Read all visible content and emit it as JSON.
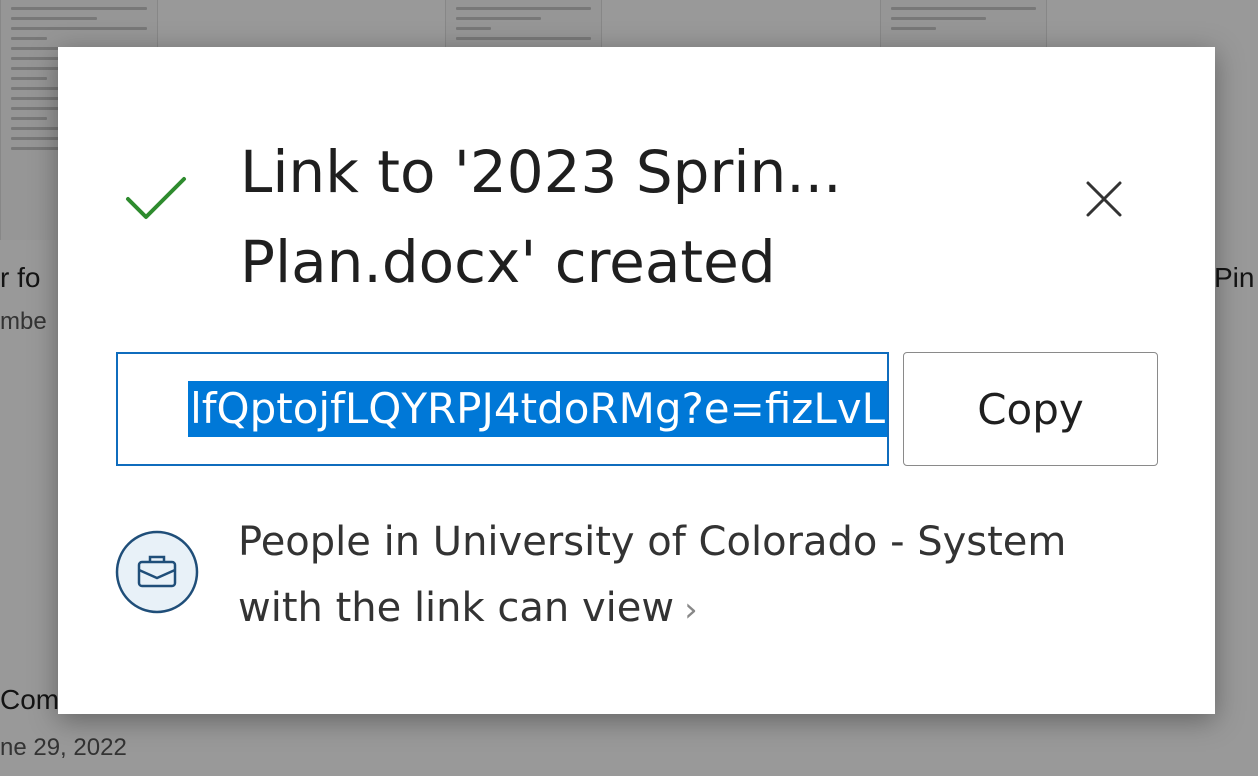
{
  "background": {
    "left_title_fragment": "r fo",
    "left_sub_fragment": "mbe",
    "right_title_fragment": "Pin",
    "bottom_title_fragment": "Comms Plan tra...",
    "bottom_date_fragment": "ne 29, 2022"
  },
  "dialog": {
    "title": "Link to '2023 Sprin... Plan.docx' created",
    "link_value": "lfQptojfLQYRPJ4tdoRMg?e=fizLvL",
    "copy_label": "Copy",
    "permission_text": "People in University of Colorado - System with the link can view",
    "chevron": "›"
  },
  "colors": {
    "check": "#2e8b2e",
    "accent": "#0f6cbd",
    "selection": "#0078d7"
  }
}
